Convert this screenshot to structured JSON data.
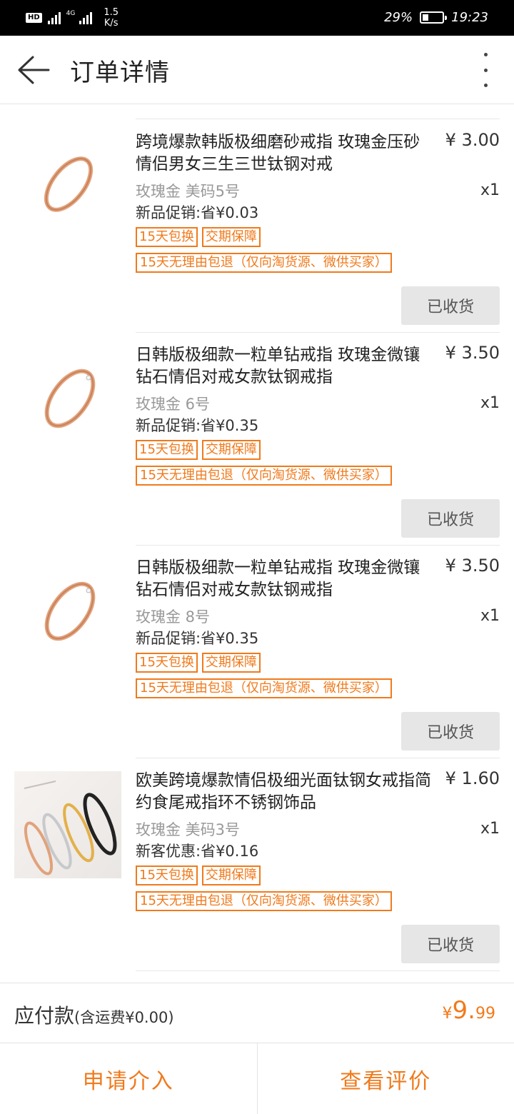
{
  "status_bar": {
    "hd_label": "HD",
    "network_label": "4G",
    "speed_value": "1.5",
    "speed_unit": "K/s",
    "battery_percent": "29%",
    "time": "19:23"
  },
  "header": {
    "title": "订单详情"
  },
  "items": [
    {
      "name": "跨境爆款韩版极细磨砂戒指 玫瑰金压砂情侣男女三生三世钛钢对戒",
      "price": "¥ 3.00",
      "qty": "x1",
      "sku": "玫瑰金 美码5号",
      "promo": "新品促销:省¥0.03",
      "tag_exchange": "15天包换",
      "tag_delivery": "交期保障",
      "tag_return": "15天无理由包退（仅向淘货源、微供买家）",
      "status_button": "已收货"
    },
    {
      "name": "日韩版极细款一粒单钻戒指 玫瑰金微镶钻石情侣对戒女款钛钢戒指",
      "price": "¥ 3.50",
      "qty": "x1",
      "sku": "玫瑰金 6号",
      "promo": "新品促销:省¥0.35",
      "tag_exchange": "15天包换",
      "tag_delivery": "交期保障",
      "tag_return": "15天无理由包退（仅向淘货源、微供买家）",
      "status_button": "已收货"
    },
    {
      "name": "日韩版极细款一粒单钻戒指 玫瑰金微镶钻石情侣对戒女款钛钢戒指",
      "price": "¥ 3.50",
      "qty": "x1",
      "sku": "玫瑰金 8号",
      "promo": "新品促销:省¥0.35",
      "tag_exchange": "15天包换",
      "tag_delivery": "交期保障",
      "tag_return": "15天无理由包退（仅向淘货源、微供买家）",
      "status_button": "已收货"
    },
    {
      "name": "欧美跨境爆款情侣极细光面钛钢女戒指简约食尾戒指环不锈钢饰品",
      "price": "¥ 1.60",
      "qty": "x1",
      "sku": "玫瑰金 美码3号",
      "promo": "新客优惠:省¥0.16",
      "tag_exchange": "15天包换",
      "tag_delivery": "交期保障",
      "tag_return": "15天无理由包退（仅向淘货源、微供买家）",
      "status_button": "已收货"
    }
  ],
  "total": {
    "label": "应付款",
    "shipping_note": "(含运费¥0.00)",
    "currency": "¥",
    "amount_int": "9.",
    "amount_dec": "99"
  },
  "actions": {
    "apply_intervention": "申请介入",
    "view_review": "查看评价"
  },
  "colors": {
    "accent": "#f07a1c",
    "button_bg": "#e6e6e6"
  }
}
